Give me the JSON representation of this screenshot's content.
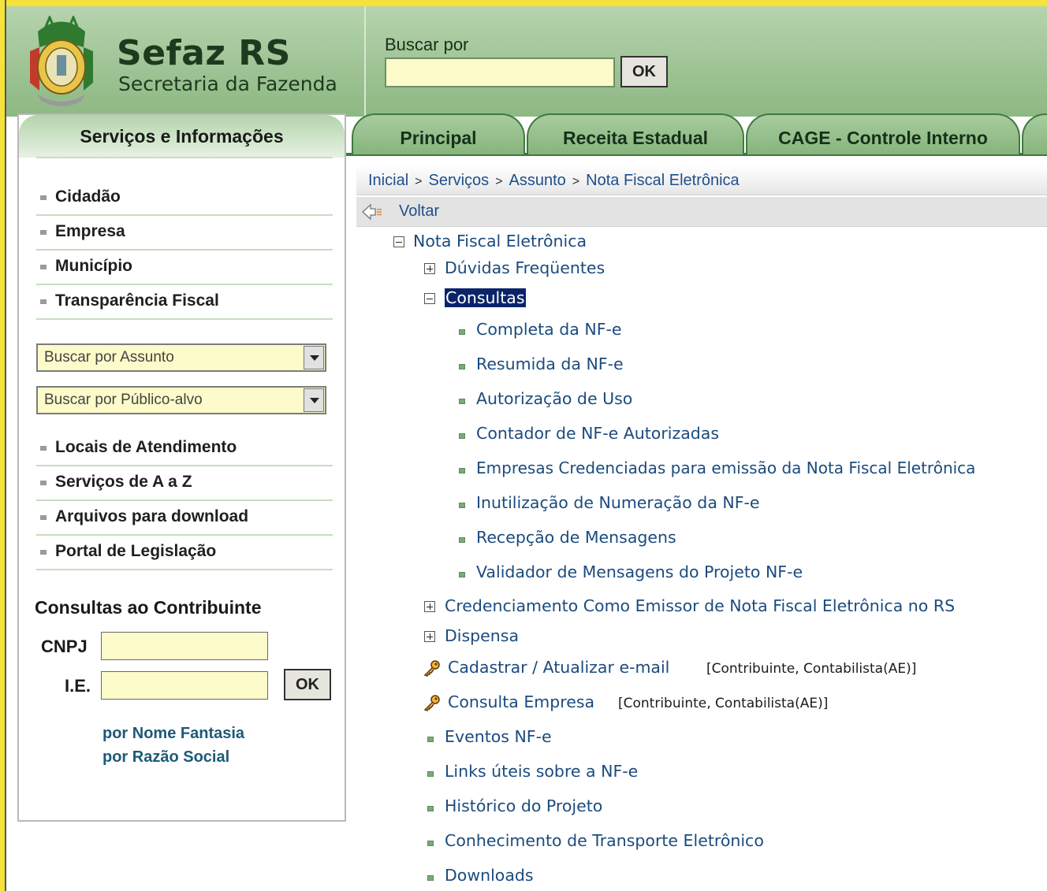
{
  "header": {
    "brand_title": "Sefaz RS",
    "brand_subtitle": "Secretaria da Fazenda",
    "search_label": "Buscar por",
    "search_value": "",
    "search_button": "OK"
  },
  "tabs": [
    "Principal",
    "Receita Estadual",
    "CAGE - Controle Interno"
  ],
  "sidebar": {
    "title": "Serviços e Informações",
    "nav": [
      "Cidadão",
      "Empresa",
      "Município",
      "Transparência Fiscal"
    ],
    "select_assunto": "Buscar por Assunto",
    "select_publico": "Buscar por Público-alvo",
    "links": [
      "Locais de Atendimento",
      "Serviços de A a Z",
      "Arquivos para download",
      "Portal de Legislação"
    ],
    "contrib_title": "Consultas ao Contribuinte",
    "cnpj_label": "CNPJ",
    "ie_label": "I.E.",
    "contrib_ok": "OK",
    "contrib_links": [
      "por Nome Fantasia",
      "por Razão Social"
    ]
  },
  "breadcrumb": [
    "Inicial",
    "Serviços",
    "Assunto",
    "Nota Fiscal Eletrônica"
  ],
  "breadcrumb_sep": ">",
  "back_label": "Voltar",
  "tree": {
    "root": "Nota Fiscal Eletrônica",
    "duvidas": "Dúvidas Freqüentes",
    "consultas": "Consultas",
    "consultas_items": [
      "Completa da NF-e",
      "Resumida da NF-e",
      "Autorização de Uso",
      "Contador de NF-e Autorizadas",
      "Empresas Credenciadas para emissão da Nota Fiscal Eletrônica",
      "Inutilização de Numeração da NF-e",
      "Recepção de Mensagens",
      "Validador de Mensagens do Projeto NF-e"
    ],
    "credenciamento": "Credenciamento Como Emissor de Nota Fiscal Eletrônica no RS",
    "dispensa": "Dispensa",
    "cadastrar": "Cadastrar / Atualizar e-mail",
    "cadastrar_tag": "[Contribuinte, Contabilista(AE)]",
    "consulta_empresa": "Consulta Empresa",
    "consulta_empresa_tag": "[Contribuinte, Contabilista(AE)]",
    "other_items": [
      "Eventos NF-e",
      "Links úteis sobre a NF-e",
      "Histórico do Projeto",
      "Conhecimento de Transporte Eletrônico",
      "Downloads"
    ]
  },
  "colors": {
    "header_green": "#9dc293",
    "tab_green": "#86b47c",
    "link_blue": "#1b4b7e",
    "input_yellow": "#fdfbc9",
    "selection_blue": "#0a246a"
  }
}
